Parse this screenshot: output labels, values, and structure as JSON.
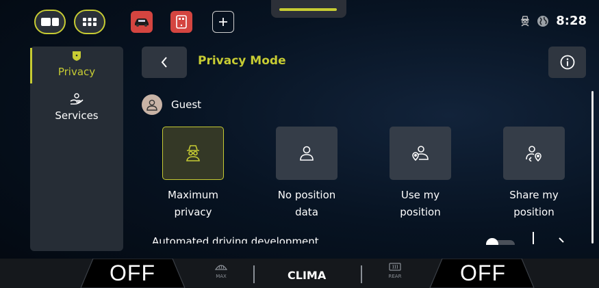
{
  "status_bar": {
    "time": "8:28"
  },
  "sidebar": {
    "items": [
      {
        "label": "Privacy",
        "active": true
      },
      {
        "label": "Services",
        "active": false
      }
    ]
  },
  "header": {
    "title": "Privacy Mode"
  },
  "profile": {
    "name": "Guest"
  },
  "privacy_options": [
    {
      "line1": "Maximum",
      "line2": "privacy",
      "icon": "spy-icon",
      "selected": true
    },
    {
      "line1": "No position",
      "line2": "data",
      "icon": "person-icon",
      "selected": false
    },
    {
      "line1": "Use my",
      "line2": "position",
      "icon": "person-location-icon",
      "selected": false
    },
    {
      "line1": "Share my",
      "line2": "position",
      "icon": "share-position-icon",
      "selected": false
    }
  ],
  "partial_row": {
    "label": "Automated driving development"
  },
  "climate": {
    "left_temp": "OFF",
    "right_temp": "OFF",
    "center_label": "CLIMA",
    "left_defrost_label": "MAX",
    "right_defrost_label": "REAR"
  },
  "colors": {
    "accent": "#c7cc33",
    "panel": "#262d36",
    "tile": "#353d48"
  }
}
